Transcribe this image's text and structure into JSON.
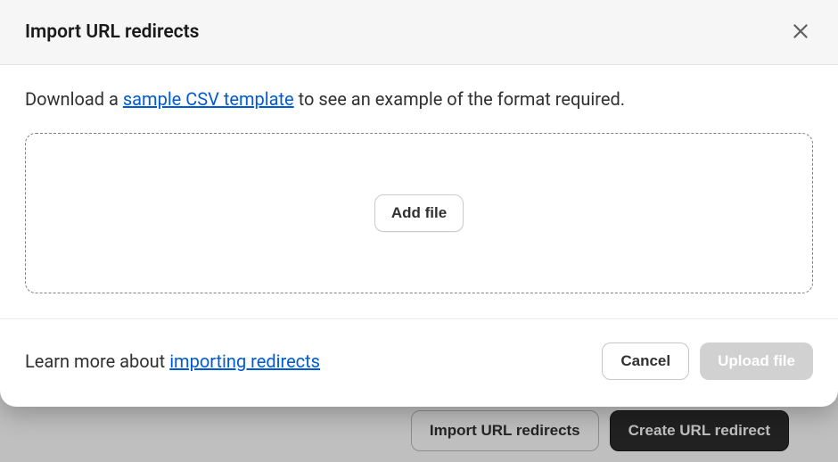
{
  "modal": {
    "title": "Import URL redirects",
    "instruction_prefix": "Download a ",
    "sample_link": "sample CSV template",
    "instruction_suffix": " to see an example of the format required.",
    "add_file_label": "Add file",
    "footer_prefix": "Learn more about ",
    "footer_link": "importing redirects",
    "cancel_label": "Cancel",
    "upload_label": "Upload file"
  },
  "background": {
    "import_label": "Import URL redirects",
    "create_label": "Create URL redirect"
  }
}
